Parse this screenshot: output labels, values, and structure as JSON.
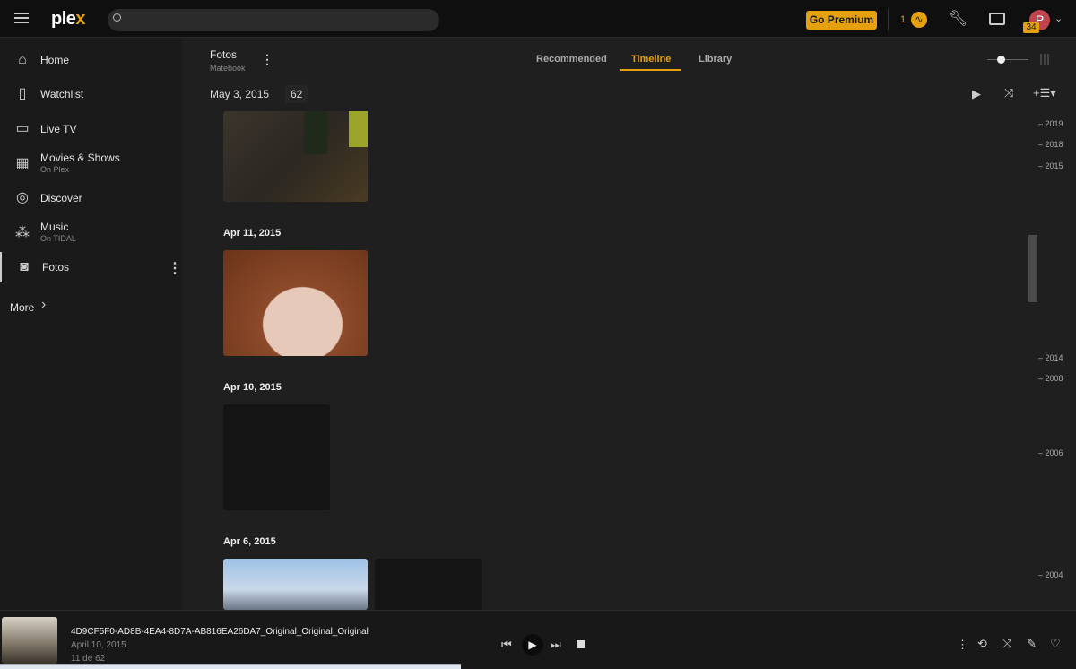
{
  "header": {
    "logo": "plex",
    "logo_accent": "x",
    "search_placeholder": "",
    "premium_label": "Go Premium",
    "activity_count": "1",
    "avatar_initial": "P",
    "notification_count": "34",
    "accent": "#e5a00d"
  },
  "sidebar": {
    "items": [
      {
        "label": "Home",
        "icon": "home-icon"
      },
      {
        "label": "Watchlist",
        "icon": "bookmark-icon"
      },
      {
        "label": "Live TV",
        "icon": "tv-icon"
      },
      {
        "label": "Movies & Shows",
        "sub": "On Plex",
        "icon": "film-icon"
      },
      {
        "label": "Discover",
        "icon": "compass-icon"
      },
      {
        "label": "Music",
        "sub": "On TIDAL",
        "icon": "tidal-icon"
      },
      {
        "label": "Fotos",
        "icon": "camera-icon"
      }
    ],
    "more_label": "More"
  },
  "library": {
    "title": "Fotos",
    "server": "Matebook",
    "current_date": "May 3, 2015",
    "count": "62"
  },
  "tabs": [
    {
      "label": "Recommended"
    },
    {
      "label": "Timeline",
      "active": true
    },
    {
      "label": "Library"
    }
  ],
  "groups": [
    {
      "date": "Apr 11, 2015"
    },
    {
      "date": "Apr 10, 2015"
    },
    {
      "date": "Apr 6, 2015"
    }
  ],
  "timeline_years": [
    "2019",
    "2018",
    "2015",
    "2014",
    "2008",
    "2006",
    "2004"
  ],
  "player": {
    "title": "4D9CF5F0-AD8B-4EA4-8D7A-AB816EA26DA7_Original_Original_Original",
    "date": "April 10, 2015",
    "position": "11 de 62"
  }
}
